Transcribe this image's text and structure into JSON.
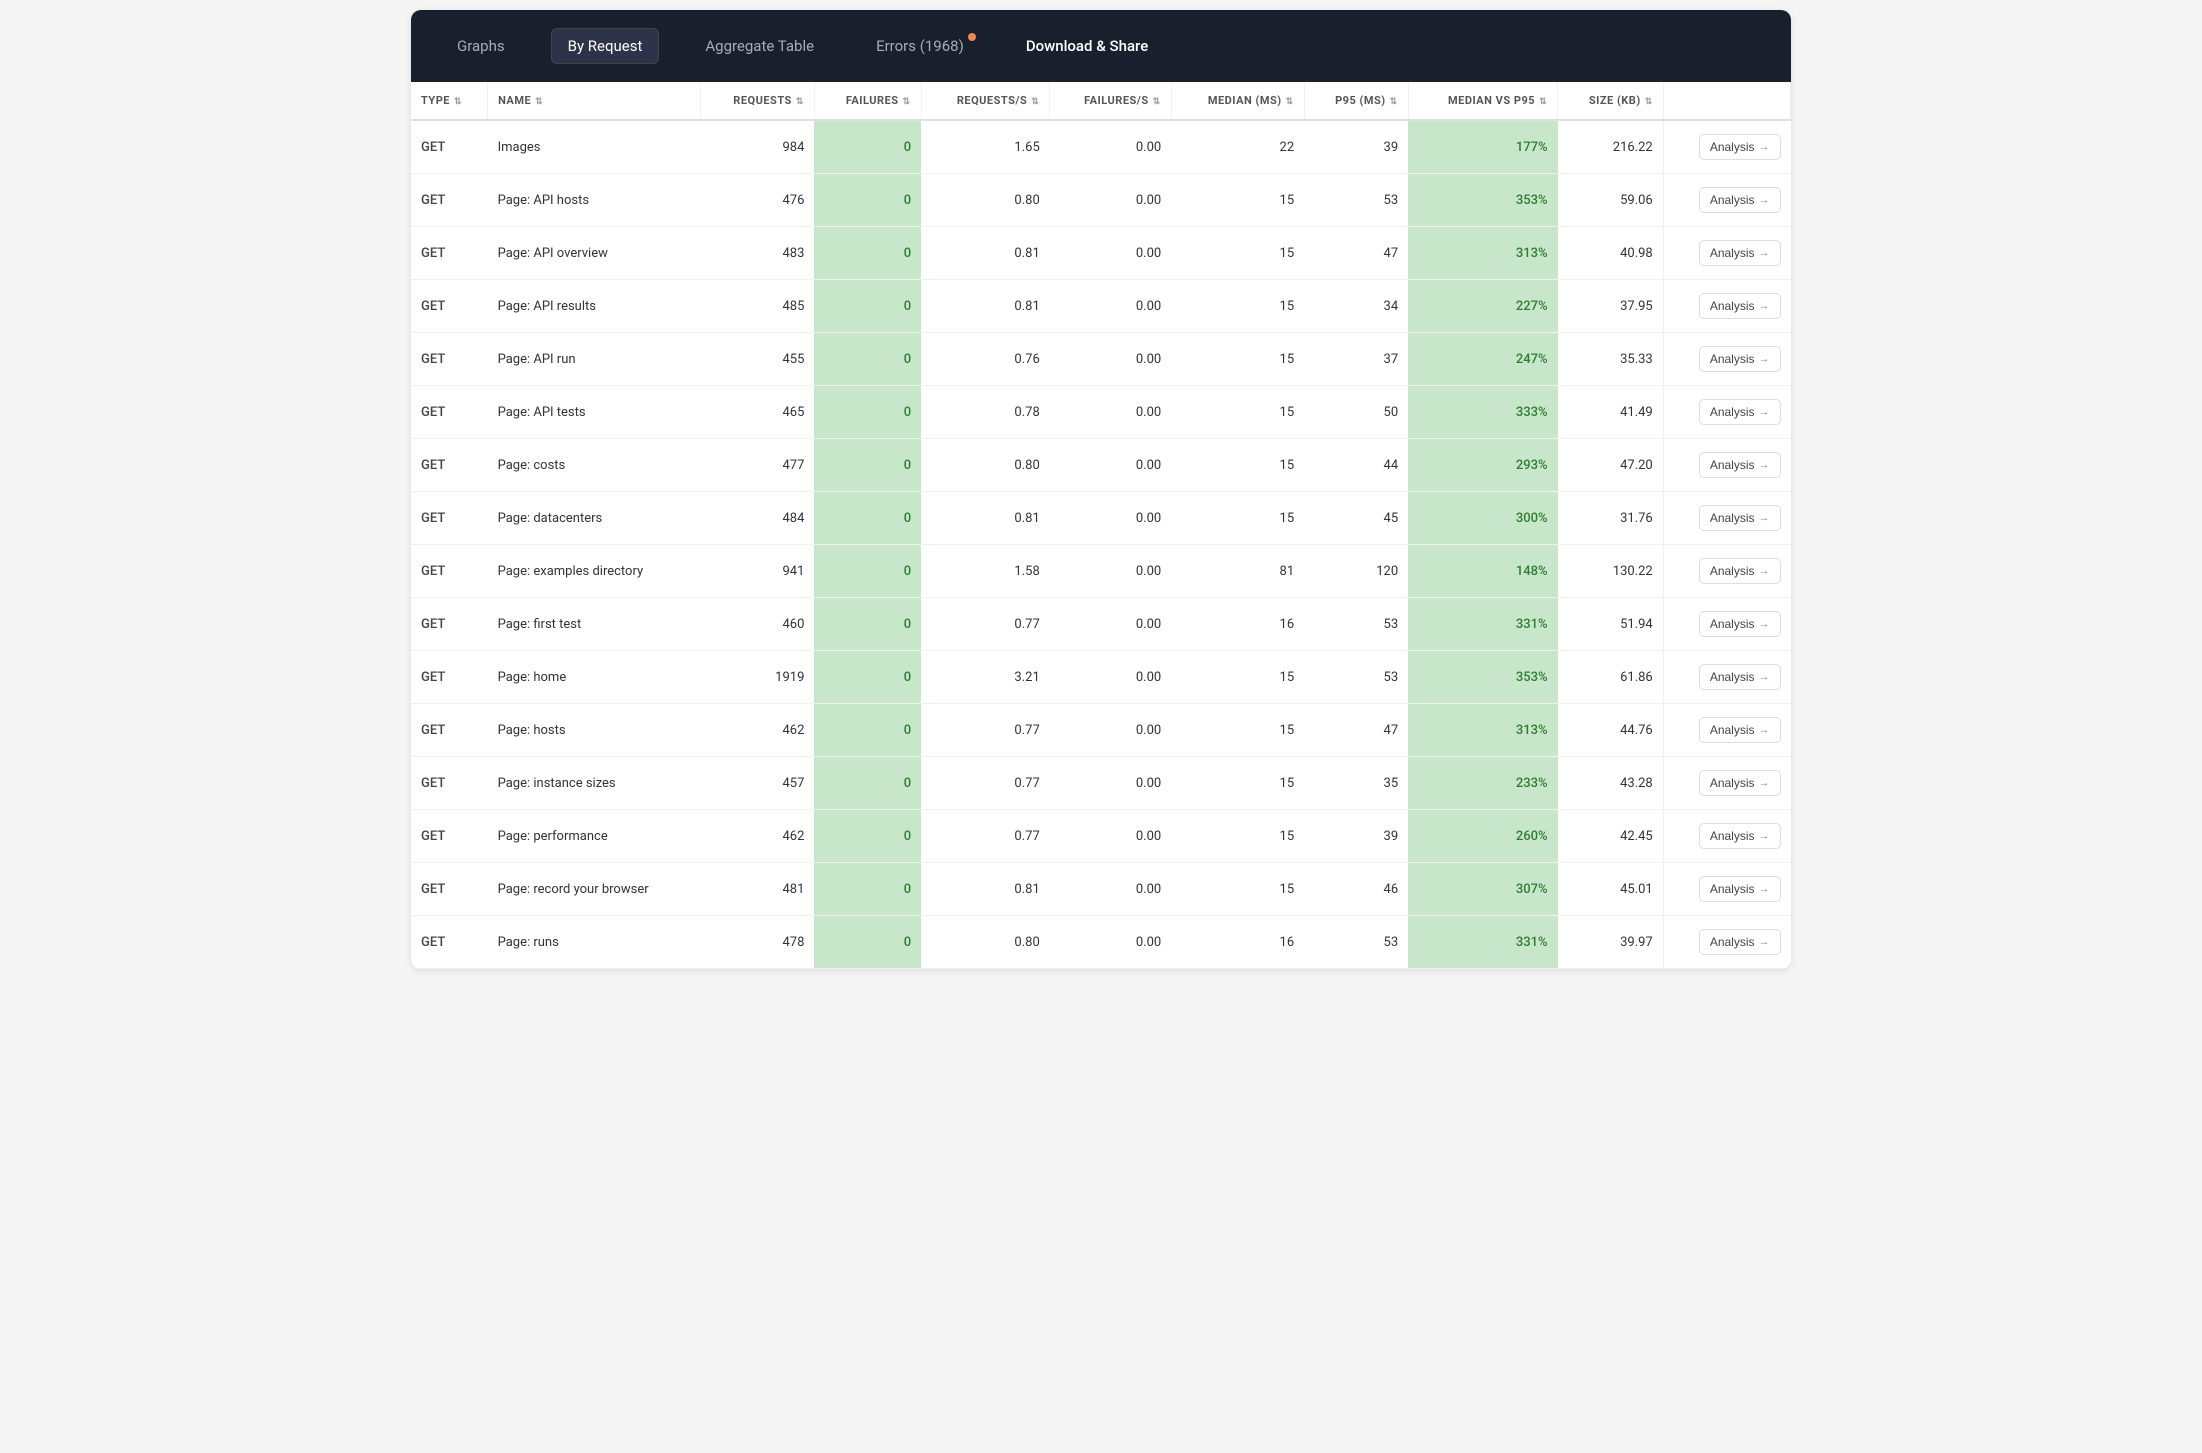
{
  "nav": {
    "items": [
      {
        "id": "graphs",
        "label": "Graphs",
        "active": false
      },
      {
        "id": "by-request",
        "label": "By Request",
        "active": true
      },
      {
        "id": "aggregate-table",
        "label": "Aggregate Table",
        "active": false
      },
      {
        "id": "errors",
        "label": "Errors (1968)",
        "active": false,
        "has_badge": true
      },
      {
        "id": "download-share",
        "label": "Download & Share",
        "active": false
      }
    ]
  },
  "table": {
    "columns": [
      {
        "id": "type",
        "label": "TYPE",
        "sortable": true
      },
      {
        "id": "name",
        "label": "NAME",
        "sortable": true
      },
      {
        "id": "requests",
        "label": "REQUESTS",
        "sortable": true
      },
      {
        "id": "failures",
        "label": "FAILURES",
        "sortable": true
      },
      {
        "id": "requests_s",
        "label": "REQUESTS/S",
        "sortable": true
      },
      {
        "id": "failures_s",
        "label": "FAILURES/S",
        "sortable": true
      },
      {
        "id": "median_ms",
        "label": "MEDIAN (MS)",
        "sortable": true
      },
      {
        "id": "p95_ms",
        "label": "P95 (MS)",
        "sortable": true
      },
      {
        "id": "median_vs_p95",
        "label": "MEDIAN VS P95",
        "sortable": true
      },
      {
        "id": "size_kb",
        "label": "SIZE (KB)",
        "sortable": true
      },
      {
        "id": "action",
        "label": "",
        "sortable": false
      }
    ],
    "rows": [
      {
        "type": "GET",
        "name": "Images",
        "requests": 984,
        "failures": 0,
        "requests_s": "1.65",
        "failures_s": "0.00",
        "median_ms": 22,
        "p95_ms": 39,
        "median_vs_p95": "177%",
        "size_kb": "216.22"
      },
      {
        "type": "GET",
        "name": "Page: API hosts",
        "requests": 476,
        "failures": 0,
        "requests_s": "0.80",
        "failures_s": "0.00",
        "median_ms": 15,
        "p95_ms": 53,
        "median_vs_p95": "353%",
        "size_kb": "59.06"
      },
      {
        "type": "GET",
        "name": "Page: API overview",
        "requests": 483,
        "failures": 0,
        "requests_s": "0.81",
        "failures_s": "0.00",
        "median_ms": 15,
        "p95_ms": 47,
        "median_vs_p95": "313%",
        "size_kb": "40.98"
      },
      {
        "type": "GET",
        "name": "Page: API results",
        "requests": 485,
        "failures": 0,
        "requests_s": "0.81",
        "failures_s": "0.00",
        "median_ms": 15,
        "p95_ms": 34,
        "median_vs_p95": "227%",
        "size_kb": "37.95"
      },
      {
        "type": "GET",
        "name": "Page: API run",
        "requests": 455,
        "failures": 0,
        "requests_s": "0.76",
        "failures_s": "0.00",
        "median_ms": 15,
        "p95_ms": 37,
        "median_vs_p95": "247%",
        "size_kb": "35.33"
      },
      {
        "type": "GET",
        "name": "Page: API tests",
        "requests": 465,
        "failures": 0,
        "requests_s": "0.78",
        "failures_s": "0.00",
        "median_ms": 15,
        "p95_ms": 50,
        "median_vs_p95": "333%",
        "size_kb": "41.49"
      },
      {
        "type": "GET",
        "name": "Page: costs",
        "requests": 477,
        "failures": 0,
        "requests_s": "0.80",
        "failures_s": "0.00",
        "median_ms": 15,
        "p95_ms": 44,
        "median_vs_p95": "293%",
        "size_kb": "47.20"
      },
      {
        "type": "GET",
        "name": "Page: datacenters",
        "requests": 484,
        "failures": 0,
        "requests_s": "0.81",
        "failures_s": "0.00",
        "median_ms": 15,
        "p95_ms": 45,
        "median_vs_p95": "300%",
        "size_kb": "31.76"
      },
      {
        "type": "GET",
        "name": "Page: examples directory",
        "requests": 941,
        "failures": 0,
        "requests_s": "1.58",
        "failures_s": "0.00",
        "median_ms": 81,
        "p95_ms": 120,
        "median_vs_p95": "148%",
        "size_kb": "130.22"
      },
      {
        "type": "GET",
        "name": "Page: first test",
        "requests": 460,
        "failures": 0,
        "requests_s": "0.77",
        "failures_s": "0.00",
        "median_ms": 16,
        "p95_ms": 53,
        "median_vs_p95": "331%",
        "size_kb": "51.94"
      },
      {
        "type": "GET",
        "name": "Page: home",
        "requests": 1919,
        "failures": 0,
        "requests_s": "3.21",
        "failures_s": "0.00",
        "median_ms": 15,
        "p95_ms": 53,
        "median_vs_p95": "353%",
        "size_kb": "61.86"
      },
      {
        "type": "GET",
        "name": "Page: hosts",
        "requests": 462,
        "failures": 0,
        "requests_s": "0.77",
        "failures_s": "0.00",
        "median_ms": 15,
        "p95_ms": 47,
        "median_vs_p95": "313%",
        "size_kb": "44.76"
      },
      {
        "type": "GET",
        "name": "Page: instance sizes",
        "requests": 457,
        "failures": 0,
        "requests_s": "0.77",
        "failures_s": "0.00",
        "median_ms": 15,
        "p95_ms": 35,
        "median_vs_p95": "233%",
        "size_kb": "43.28"
      },
      {
        "type": "GET",
        "name": "Page: performance",
        "requests": 462,
        "failures": 0,
        "requests_s": "0.77",
        "failures_s": "0.00",
        "median_ms": 15,
        "p95_ms": 39,
        "median_vs_p95": "260%",
        "size_kb": "42.45"
      },
      {
        "type": "GET",
        "name": "Page: record your browser",
        "requests": 481,
        "failures": 0,
        "requests_s": "0.81",
        "failures_s": "0.00",
        "median_ms": 15,
        "p95_ms": 46,
        "median_vs_p95": "307%",
        "size_kb": "45.01"
      },
      {
        "type": "GET",
        "name": "Page: runs",
        "requests": 478,
        "failures": 0,
        "requests_s": "0.80",
        "failures_s": "0.00",
        "median_ms": 16,
        "p95_ms": 53,
        "median_vs_p95": "331%",
        "size_kb": "39.97"
      }
    ],
    "analysis_label": "Analysis",
    "analysis_arrow": "→"
  }
}
